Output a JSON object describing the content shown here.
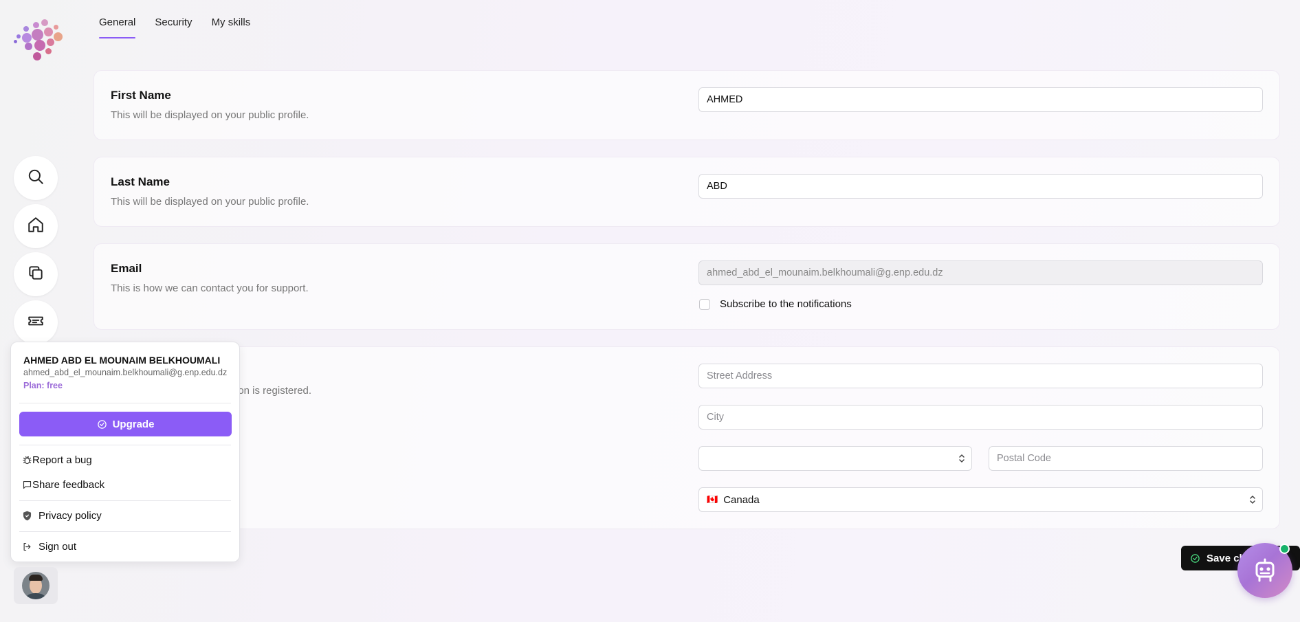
{
  "tabs": [
    {
      "label": "General",
      "active": true
    },
    {
      "label": "Security",
      "active": false
    },
    {
      "label": "My skills",
      "active": false
    }
  ],
  "sidebar": {
    "icons": [
      "search-icon",
      "home-icon",
      "copy-icon",
      "ticket-icon"
    ]
  },
  "sections": {
    "first_name": {
      "title": "First Name",
      "description": "This will be displayed on your public profile.",
      "value": "AHMED"
    },
    "last_name": {
      "title": "Last Name",
      "description": "This will be displayed on your public profile.",
      "value": "ABD"
    },
    "email": {
      "title": "Email",
      "description": "This is how we can contact you for support.",
      "value": "ahmed_abd_el_mounaim.belkhoumali@g.enp.edu.dz",
      "subscribe_label": "Subscribe to the notifications",
      "subscribed": false
    },
    "address": {
      "description_visible": "ion is registered.",
      "street_placeholder": "Street Address",
      "city_placeholder": "City",
      "state_value": "",
      "postal_placeholder": "Postal Code",
      "country_value": "Canada",
      "country_flag": "🇨🇦"
    }
  },
  "user_menu": {
    "name": "AHMED ABD EL MOUNAIM BELKHOUMALI",
    "email": "ahmed_abd_el_mounaim.belkhoumali@g.enp.edu.dz",
    "plan": "Plan: free",
    "upgrade_label": "Upgrade",
    "report_bug": "Report a bug",
    "share_feedback": "Share feedback",
    "privacy_policy": "Privacy policy",
    "sign_out": "Sign out"
  },
  "save_label": "Save ch",
  "colors": {
    "accent": "#8b5cf6",
    "plan": "#9b6bd8",
    "online": "#17b26a",
    "save_bg": "#111111"
  }
}
